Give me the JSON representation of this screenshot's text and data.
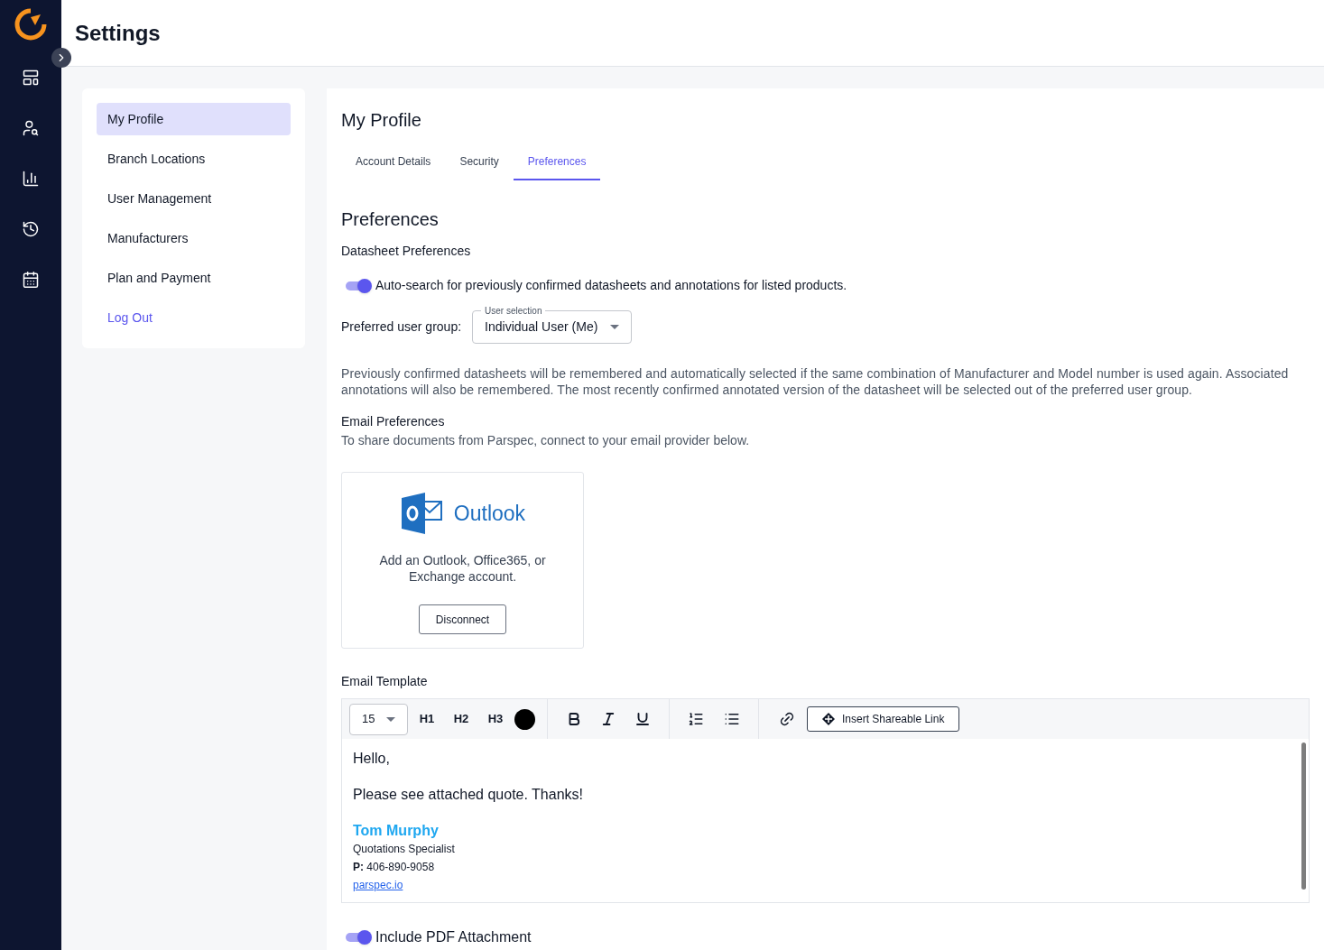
{
  "page_title": "Settings",
  "menu": [
    {
      "label": "My Profile",
      "selected": true,
      "kind": "item"
    },
    {
      "label": "Branch Locations",
      "selected": false,
      "kind": "item"
    },
    {
      "label": "User Management",
      "selected": false,
      "kind": "item"
    },
    {
      "label": "Manufacturers",
      "selected": false,
      "kind": "item"
    },
    {
      "label": "Plan and Payment",
      "selected": false,
      "kind": "item"
    },
    {
      "label": "Log Out",
      "selected": false,
      "kind": "logout"
    }
  ],
  "profile": {
    "heading": "My Profile",
    "tabs": [
      {
        "label": "Account Details",
        "selected": false
      },
      {
        "label": "Security",
        "selected": false
      },
      {
        "label": "Preferences",
        "selected": true
      }
    ]
  },
  "preferences": {
    "heading": "Preferences",
    "datasheet": {
      "heading": "Datasheet Preferences",
      "autosearch": {
        "on": true,
        "label": "Auto-search for previously confirmed datasheets and annotations for listed products."
      },
      "user_group": {
        "label": "Preferred user group:",
        "field_label": "User selection",
        "value": "Individual User (Me)"
      },
      "note": "Previously confirmed datasheets will be remembered and automatically selected if the same combination of Manufacturer and Model number is used again. Associated annotations will also be remembered. The most recently confirmed annotated version of the datasheet will be selected out of the preferred user group."
    },
    "email": {
      "heading": "Email Preferences",
      "description": "To share documents from Parspec, connect to your email provider below.",
      "provider": {
        "name": "Outlook",
        "description": "Add an Outlook, Office365, or Exchange account.",
        "button": "Disconnect"
      }
    },
    "template": {
      "heading": "Email Template",
      "toolbar": {
        "font_size": "15",
        "headings": [
          "H1",
          "H2",
          "H3"
        ],
        "link_button": "Insert Shareable Link"
      },
      "body": {
        "greeting": "Hello,",
        "message": "Please see attached quote. Thanks!",
        "signature": {
          "name": "Tom Murphy",
          "title": "Quotations Specialist",
          "phone": "**P:** 406-890-9058",
          "link": "parspec.io"
        }
      }
    },
    "include_pdf": {
      "on": true,
      "label": "Include PDF Attachment"
    }
  }
}
